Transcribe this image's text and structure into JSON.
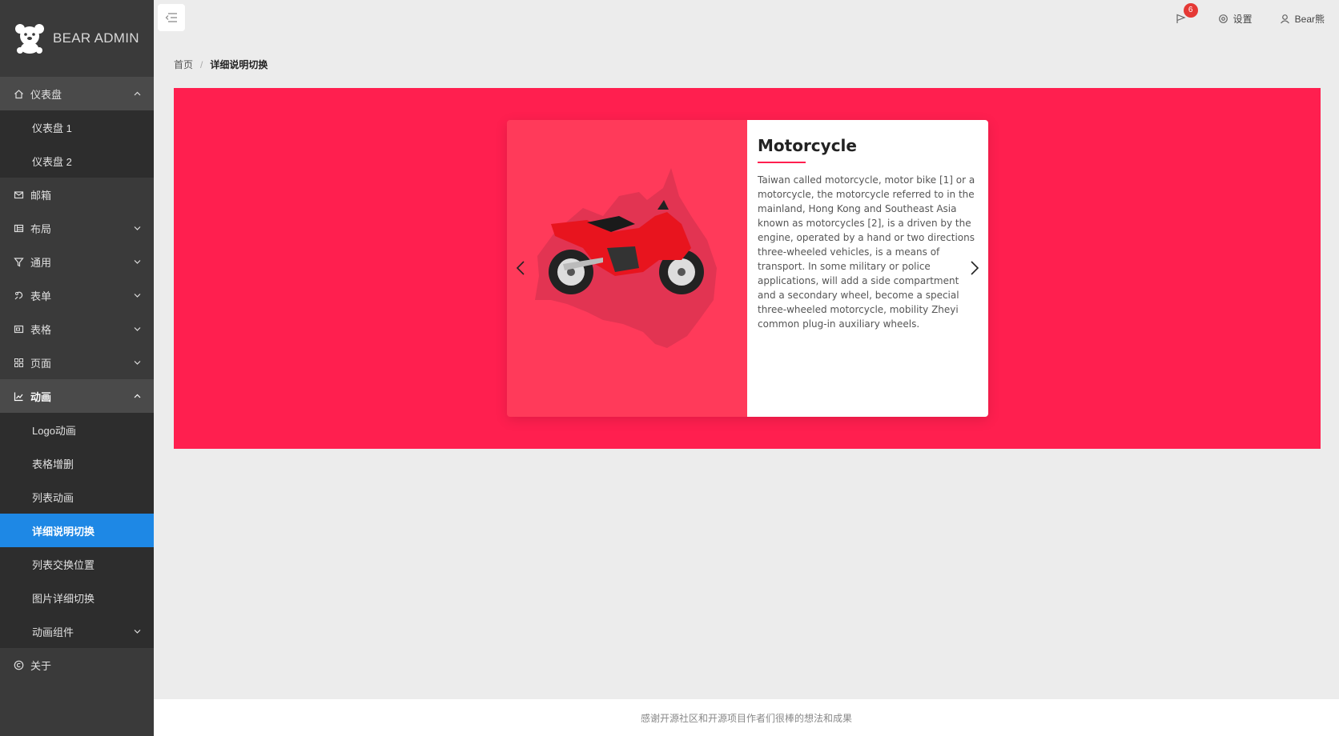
{
  "brand": {
    "name": "BEAR ADMIN"
  },
  "sidebar": {
    "groups": [
      {
        "label": "仪表盘",
        "icon": "home-icon",
        "open": true,
        "children": [
          {
            "label": "仪表盘 1"
          },
          {
            "label": "仪表盘 2"
          }
        ]
      },
      {
        "label": "邮箱",
        "icon": "mail-icon"
      },
      {
        "label": "布局",
        "icon": "layout-icon"
      },
      {
        "label": "通用",
        "icon": "filter-icon"
      },
      {
        "label": "表单",
        "icon": "form-icon"
      },
      {
        "label": "表格",
        "icon": "table-icon"
      },
      {
        "label": "页面",
        "icon": "grid-icon"
      },
      {
        "label": "动画",
        "icon": "chart-icon",
        "open": true,
        "children": [
          {
            "label": "Logo动画"
          },
          {
            "label": "表格增删"
          },
          {
            "label": "列表动画"
          },
          {
            "label": "详细说明切换",
            "selected": true
          },
          {
            "label": "列表交换位置"
          },
          {
            "label": "图片详细切换"
          },
          {
            "label": "动画组件"
          }
        ]
      },
      {
        "label": "关于",
        "icon": "copyright-icon"
      }
    ]
  },
  "topbar": {
    "notifications_count": "6",
    "settings_label": "设置",
    "user_label": "Bear熊"
  },
  "breadcrumb": {
    "home": "首页",
    "separator": "/",
    "current": "详细说明切换"
  },
  "card": {
    "title": "Motorcycle",
    "description": "Taiwan called motorcycle, motor bike [1] or a motorcycle, the motorcycle referred to in the mainland, Hong Kong and Southeast Asia known as motorcycles [2], is a driven by the engine, operated by a hand or two directions three-wheeled vehicles, is a means of transport. In some military or police applications, will add a side compartment and a secondary wheel, become a special three-wheeled motorcycle, mobility Zheyi common plug-in auxiliary wheels."
  },
  "footer": {
    "text": "感谢开源社区和开源项目作者们很棒的想法和成果"
  },
  "colors": {
    "accent": "#ff1f4f",
    "sidebar_bg": "#3a3a3a",
    "selected": "#1e88e5",
    "badge": "#e53935"
  }
}
